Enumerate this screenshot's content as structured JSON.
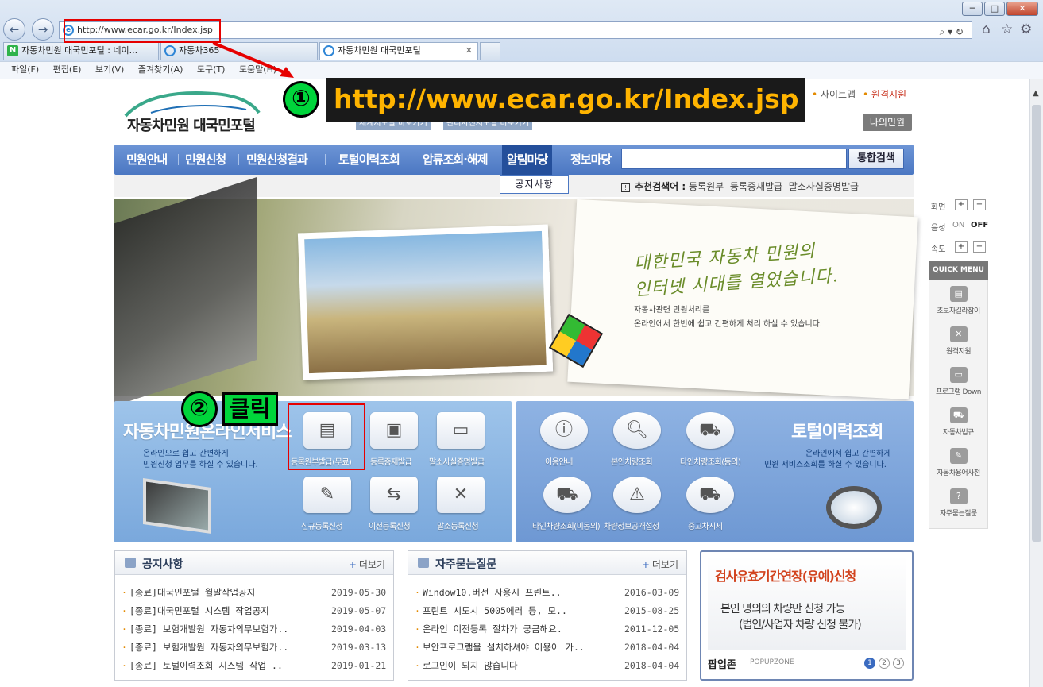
{
  "browser": {
    "address": "http://www.ecar.go.kr/Index.jsp",
    "tabs": [
      {
        "label": "자동차민원 대국민포털 : 네이..."
      },
      {
        "label": "자동차365"
      },
      {
        "label": "자동차민원 대국민포털"
      }
    ],
    "menu": [
      "파일(F)",
      "편집(E)",
      "보기(V)",
      "즐겨찾기(A)",
      "도구(T)",
      "도움말(H)"
    ],
    "window_buttons": [
      "─",
      "□",
      "✕"
    ]
  },
  "annotations": {
    "step1_number": "①",
    "step1_text": "http://www.ecar.go.kr/Index.jsp",
    "step2_number": "②",
    "step2_text": "클릭",
    "accent": "#e60000",
    "callout_color": "#ffb400"
  },
  "header": {
    "logo_text": "자동차민원 대국민포털",
    "sitemap": "사이트맵",
    "remote": "원격지원",
    "mini_buttons": [
      "세계지도말 바로가기",
      "관리자전지도말 바로가기"
    ],
    "my_minwon": "나의민원"
  },
  "gnb": {
    "items": [
      "민원안내",
      "민원신청",
      "민원신청결과",
      "토털이력조회",
      "압류조회·해제",
      "알림마당",
      "정보마당"
    ],
    "active": "알림마당",
    "search_button": "통합검색",
    "submenu": "공지사항",
    "recommend_label": "추천검색어 :",
    "recommend_words": [
      "등록원부",
      "등록증재발급",
      "말소사실증명발급"
    ]
  },
  "banner": {
    "headline1": "대한민국 자동차 민원의",
    "headline2": "인터넷 시대를 열었습니다.",
    "desc1": "자동차관련 민원처리를",
    "desc2": "온라인에서 한번에 쉽고 간편하게 처리 하실 수 있습니다."
  },
  "services_left": {
    "title": "자동차민원온라인서비스",
    "desc1": "온라인으로 쉽고 간편하게",
    "desc2": "민원신청 업무를 하실 수 있습니다.",
    "items": [
      {
        "label": "등록원부발급(무료)",
        "icon": "document-icon"
      },
      {
        "label": "등록증재발급",
        "icon": "reissue-icon"
      },
      {
        "label": "말소사실증명발급",
        "icon": "monitor-icon"
      },
      {
        "label": "신규등록신청",
        "icon": "new-register-icon"
      },
      {
        "label": "이전등록신청",
        "icon": "transfer-icon"
      },
      {
        "label": "말소등록신청",
        "icon": "cancel-register-icon"
      }
    ]
  },
  "services_right": {
    "title": "토털이력조회",
    "desc1": "온라인에서 쉽고 간편하게",
    "desc2": "민원 서비스조회를 하실 수 있습니다.",
    "items": [
      {
        "label": "이용안내",
        "icon": "info-icon"
      },
      {
        "label": "본인차량조회",
        "icon": "car-search-icon"
      },
      {
        "label": "타인차량조회(동의)",
        "icon": "car-icon"
      },
      {
        "label": "타인차량조회(미동의)",
        "icon": "car-magnify-icon"
      },
      {
        "label": "차량정보공개설정",
        "icon": "warning-icon"
      },
      {
        "label": "중고차시세",
        "icon": "used-car-icon"
      }
    ]
  },
  "notice": {
    "title": "공지사항",
    "more": "더보기",
    "rows": [
      {
        "text": "[종료]대국민포털 월말작업공지",
        "date": "2019-05-30"
      },
      {
        "text": "[종료]대국민포털 시스템 작업공지",
        "date": "2019-05-07"
      },
      {
        "text": "[종료] 보험개발원 자동차의무보험가..",
        "date": "2019-04-03"
      },
      {
        "text": "[종료] 보험개발원 자동차의무보험가..",
        "date": "2019-03-13"
      },
      {
        "text": "[종료] 토털이력조회 시스템 작업 ..",
        "date": "2019-01-21"
      }
    ]
  },
  "faq": {
    "title": "자주묻는질문",
    "more": "더보기",
    "rows": [
      {
        "text": "Window10.버전 사용시 프린트..",
        "date": "2016-03-09"
      },
      {
        "text": "프린트 시도시 5005에러 등,  모..",
        "date": "2015-08-25"
      },
      {
        "text": "온라인 이전등록 절차가 궁금해요.",
        "date": "2011-12-05"
      },
      {
        "text": "보안프로그램을 설치하셔야 이용이 가..",
        "date": "2018-04-04"
      },
      {
        "text": "로그인이 되지 않습니다",
        "date": "2018-04-04"
      }
    ]
  },
  "popup": {
    "title": "검사유효기간연장(유예)신청",
    "line1": "본인 명의의 차량만 신청 가능",
    "line2": "(법인/사업자 차량 신청 불가)",
    "zone_label": "팝업존",
    "zone_en": "POPUPZONE",
    "pages": [
      "1",
      "2",
      "3"
    ]
  },
  "quick": {
    "screen_label": "화면",
    "voice_label": "음성",
    "voice_on": "ON",
    "voice_off": "OFF",
    "speed_label": "속도",
    "plus": "+",
    "minus": "−",
    "menu_title": "QUICK MENU",
    "items": [
      {
        "label": "초보자길라잡이",
        "icon": "guide-icon"
      },
      {
        "label": "원격지원",
        "icon": "tools-icon"
      },
      {
        "label": "프로그램 Down",
        "icon": "download-icon"
      },
      {
        "label": "자동차법규",
        "icon": "law-icon"
      },
      {
        "label": "자동차용어사전",
        "icon": "dictionary-icon"
      },
      {
        "label": "자주묻는질문",
        "icon": "faq-icon"
      }
    ]
  }
}
